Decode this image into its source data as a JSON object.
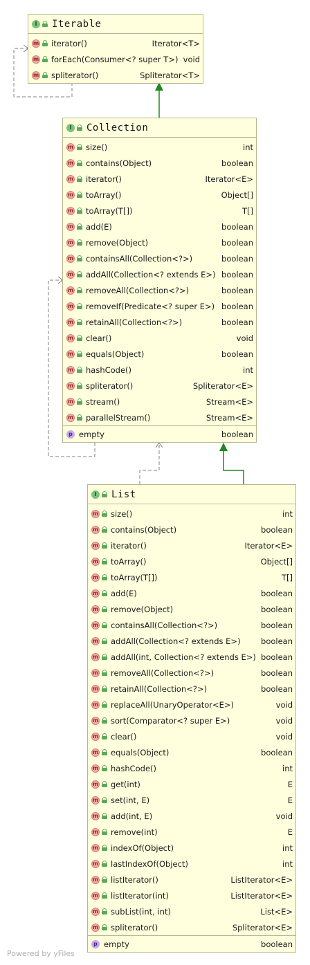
{
  "nodes": [
    {
      "id": "iterable",
      "title": "Iterable",
      "methods": [
        {
          "name": "iterator()",
          "type": "Iterator<T>"
        },
        {
          "name": "forEach(Consumer<? super T>)",
          "type": "void"
        },
        {
          "name": "spliterator()",
          "type": "Spliterator<T>"
        }
      ],
      "properties": []
    },
    {
      "id": "collection",
      "title": "Collection",
      "methods": [
        {
          "name": "size()",
          "type": "int"
        },
        {
          "name": "contains(Object)",
          "type": "boolean"
        },
        {
          "name": "iterator()",
          "type": "Iterator<E>"
        },
        {
          "name": "toArray()",
          "type": "Object[]"
        },
        {
          "name": "toArray(T[])",
          "type": "T[]"
        },
        {
          "name": "add(E)",
          "type": "boolean"
        },
        {
          "name": "remove(Object)",
          "type": "boolean"
        },
        {
          "name": "containsAll(Collection<?>)",
          "type": "boolean"
        },
        {
          "name": "addAll(Collection<? extends E>)",
          "type": "boolean"
        },
        {
          "name": "removeAll(Collection<?>)",
          "type": "boolean"
        },
        {
          "name": "removeIf(Predicate<? super E>)",
          "type": "boolean"
        },
        {
          "name": "retainAll(Collection<?>)",
          "type": "boolean"
        },
        {
          "name": "clear()",
          "type": "void"
        },
        {
          "name": "equals(Object)",
          "type": "boolean"
        },
        {
          "name": "hashCode()",
          "type": "int"
        },
        {
          "name": "spliterator()",
          "type": "Spliterator<E>"
        },
        {
          "name": "stream()",
          "type": "Stream<E>"
        },
        {
          "name": "parallelStream()",
          "type": "Stream<E>"
        }
      ],
      "properties": [
        {
          "name": "empty",
          "type": "boolean"
        }
      ]
    },
    {
      "id": "list",
      "title": "List",
      "methods": [
        {
          "name": "size()",
          "type": "int"
        },
        {
          "name": "contains(Object)",
          "type": "boolean"
        },
        {
          "name": "iterator()",
          "type": "Iterator<E>"
        },
        {
          "name": "toArray()",
          "type": "Object[]"
        },
        {
          "name": "toArray(T[])",
          "type": "T[]"
        },
        {
          "name": "add(E)",
          "type": "boolean"
        },
        {
          "name": "remove(Object)",
          "type": "boolean"
        },
        {
          "name": "containsAll(Collection<?>)",
          "type": "boolean"
        },
        {
          "name": "addAll(Collection<? extends E>)",
          "type": "boolean"
        },
        {
          "name": "addAll(int, Collection<? extends E>)",
          "type": "boolean"
        },
        {
          "name": "removeAll(Collection<?>)",
          "type": "boolean"
        },
        {
          "name": "retainAll(Collection<?>)",
          "type": "boolean"
        },
        {
          "name": "replaceAll(UnaryOperator<E>)",
          "type": "void"
        },
        {
          "name": "sort(Comparator<? super E>)",
          "type": "void"
        },
        {
          "name": "clear()",
          "type": "void"
        },
        {
          "name": "equals(Object)",
          "type": "boolean"
        },
        {
          "name": "hashCode()",
          "type": "int"
        },
        {
          "name": "get(int)",
          "type": "E"
        },
        {
          "name": "set(int, E)",
          "type": "E"
        },
        {
          "name": "add(int, E)",
          "type": "void"
        },
        {
          "name": "remove(int)",
          "type": "E"
        },
        {
          "name": "indexOf(Object)",
          "type": "int"
        },
        {
          "name": "lastIndexOf(Object)",
          "type": "int"
        },
        {
          "name": "listIterator()",
          "type": "ListIterator<E>"
        },
        {
          "name": "listIterator(int)",
          "type": "ListIterator<E>"
        },
        {
          "name": "subList(int, int)",
          "type": "List<E>"
        },
        {
          "name": "spliterator()",
          "type": "Spliterator<E>"
        }
      ],
      "properties": [
        {
          "name": "empty",
          "type": "boolean"
        }
      ]
    }
  ],
  "icons": {
    "interface_badge": "I",
    "method_badge": "m",
    "property_badge": "p"
  },
  "colors": {
    "node_fill": "#ffffdd",
    "node_border": "#b7b78f",
    "extends_edge": "#1e8a1e",
    "dependency_edge": "#808080"
  },
  "footer": "Powered by yFiles"
}
